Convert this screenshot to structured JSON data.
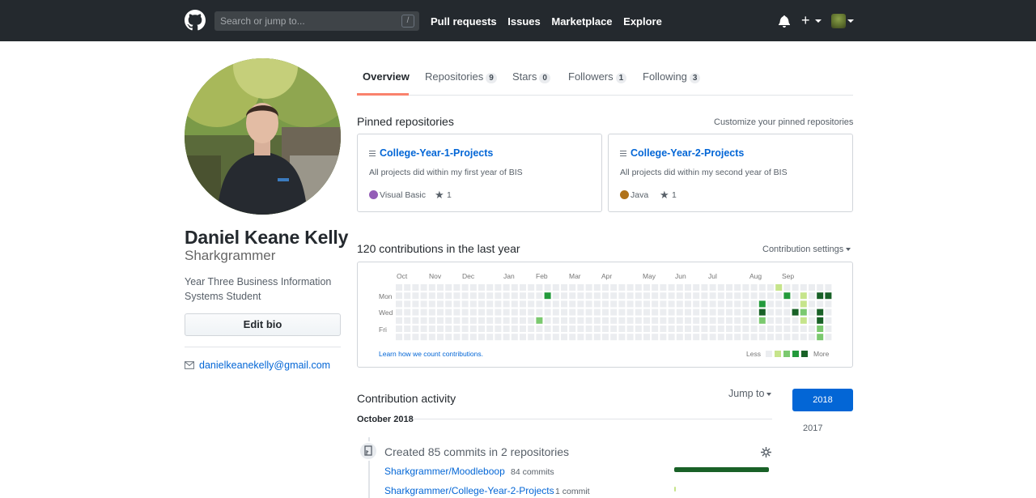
{
  "colors": {
    "header_bg": "#24292e",
    "link": "#0366d6",
    "tab_underline": "#f9826c",
    "visual_basic": "#945db7",
    "java": "#b07219",
    "year_selected": "#0366d6",
    "contrib_levels": [
      "#ebedf0",
      "#c6e48b",
      "#7bc96f",
      "#239a3b",
      "#196127"
    ]
  },
  "header": {
    "logo_icon": "github-logo-icon",
    "search_placeholder": "Search or jump to...",
    "search_key": "/",
    "nav": [
      "Pull requests",
      "Issues",
      "Marketplace",
      "Explore"
    ],
    "icons": [
      "bell-icon",
      "plus-icon",
      "avatar-icon"
    ]
  },
  "profile": {
    "full_name": "Daniel Keane Kelly",
    "username": "Sharkgrammer",
    "bio": "Year Three Business Information Systems Student",
    "edit_bio_label": "Edit bio",
    "email": "danielkeanekelly@gmail.com"
  },
  "tabs": [
    {
      "label": "Overview",
      "count": null,
      "active": true
    },
    {
      "label": "Repositories",
      "count": "9"
    },
    {
      "label": "Stars",
      "count": "0"
    },
    {
      "label": "Followers",
      "count": "1"
    },
    {
      "label": "Following",
      "count": "3"
    }
  ],
  "pinned": {
    "title": "Pinned repositories",
    "customize": "Customize your pinned repositories",
    "repos": [
      {
        "name": "College-Year-1-Projects",
        "description": "All projects did within my first year of BIS",
        "language": "Visual Basic",
        "stars": "1"
      },
      {
        "name": "College-Year-2-Projects",
        "description": "All projects did within my second year of BIS",
        "language": "Java",
        "stars": "1"
      }
    ]
  },
  "contributions": {
    "title": "120 contributions in the last year",
    "settings": "Contribution settings",
    "months": [
      "Oct",
      "Nov",
      "Dec",
      "Jan",
      "Feb",
      "Mar",
      "Apr",
      "May",
      "Jun",
      "Jul",
      "Aug",
      "Sep"
    ],
    "days": [
      "Mon",
      "Wed",
      "Fri"
    ],
    "learn": "Learn how we count contributions.",
    "less": "Less",
    "more": "More",
    "active_cells": [
      {
        "week": 18,
        "day": 1,
        "level": 3
      },
      {
        "week": 17,
        "day": 4,
        "level": 2
      },
      {
        "week": 44,
        "day": 2,
        "level": 3
      },
      {
        "week": 44,
        "day": 3,
        "level": 4
      },
      {
        "week": 44,
        "day": 4,
        "level": 2
      },
      {
        "week": 46,
        "day": 0,
        "level": 1
      },
      {
        "week": 47,
        "day": 1,
        "level": 3
      },
      {
        "week": 48,
        "day": 3,
        "level": 4
      },
      {
        "week": 49,
        "day": 1,
        "level": 1
      },
      {
        "week": 49,
        "day": 2,
        "level": 1
      },
      {
        "week": 49,
        "day": 3,
        "level": 2
      },
      {
        "week": 49,
        "day": 4,
        "level": 1
      },
      {
        "week": 51,
        "day": 1,
        "level": 4
      },
      {
        "week": 51,
        "day": 3,
        "level": 4
      },
      {
        "week": 51,
        "day": 4,
        "level": 4
      },
      {
        "week": 51,
        "day": 5,
        "level": 2
      },
      {
        "week": 51,
        "day": 6,
        "level": 2
      },
      {
        "week": 52,
        "day": 1,
        "level": 4
      }
    ]
  },
  "activity": {
    "title": "Contribution activity",
    "jump_to": "Jump to",
    "years": [
      "2018",
      "2017"
    ],
    "month": "October 2018",
    "summary": "Created 85 commits in 2 repositories",
    "repos": [
      {
        "name": "Sharkgrammer/Moodleboop",
        "commits": "84 commits",
        "share": 0.99
      },
      {
        "name": "Sharkgrammer/College-Year-2-Projects",
        "commits": "1 commit",
        "share": 0.01
      }
    ]
  }
}
